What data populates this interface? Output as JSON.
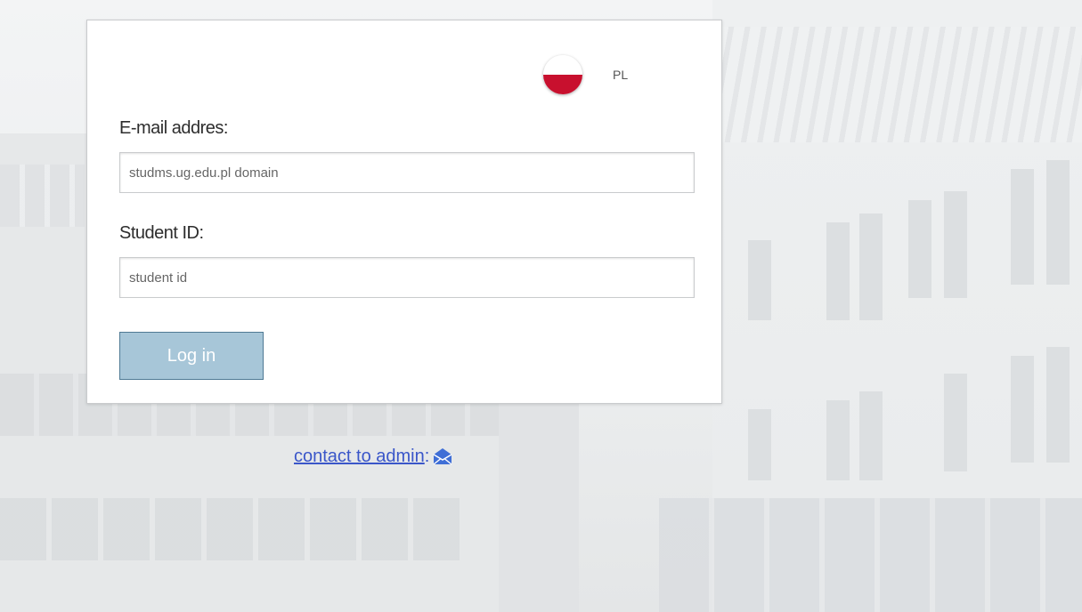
{
  "language": {
    "code": "PL",
    "flag_icon": "poland-flag-icon",
    "flag_colors": {
      "top": "#ffffff",
      "bottom": "#c8102e"
    }
  },
  "form": {
    "email_label": "E-mail addres:",
    "email_placeholder": "studms.ug.edu.pl domain",
    "email_value": "",
    "student_id_label": "Student ID:",
    "student_id_placeholder": "student id",
    "student_id_value": "",
    "login_button": "Log in",
    "login_button_color": "#a7c6d8"
  },
  "contact": {
    "link_text": "contact to admin",
    "separator": ":",
    "icon": "envelope-icon",
    "link_color": "#3a56c9"
  }
}
